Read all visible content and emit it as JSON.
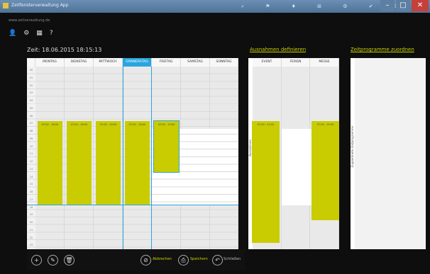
{
  "window": {
    "title": "Zeitfensterverwaltung App",
    "minimize": "–",
    "maximize": "□",
    "close": "✕",
    "toolbar_icons": "⌕ ⚑ ♦ ⊞ ⚙ ✔ ☰"
  },
  "nav": {
    "url": "www.zeitverwaltung.de",
    "user_icon": "👤",
    "settings_icon": "⚙",
    "calendar_icon": "▦",
    "help_icon": "?"
  },
  "header": {
    "zeit": "Zeit: 18.06.2015 18:15:13"
  },
  "links": {
    "ausnahmen": "Ausnahmen definieren",
    "zeitprogramme": "Zeitprogramme zuordnen"
  },
  "week": {
    "days": [
      "MONTAG",
      "DIENSTAG",
      "MITTWOCH",
      "DONNERSTAG",
      "FREITAG",
      "SAMSTAG",
      "SONNTAG"
    ],
    "selected_day": "DONNERSTAG",
    "hours": [
      "00",
      "01",
      "02",
      "03",
      "04",
      "05",
      "06",
      "07",
      "08",
      "09",
      "10",
      "11",
      "12",
      "13",
      "14",
      "15",
      "16",
      "17",
      "18",
      "19",
      "20",
      "21",
      "22",
      "23"
    ],
    "blocks": [
      {
        "day": "MONTAG",
        "label": "07:00 - 16:00"
      },
      {
        "day": "DIENSTAG",
        "label": "07:00 - 16:00"
      },
      {
        "day": "MITTWOCH",
        "label": "07:00 - 16:00"
      },
      {
        "day": "DONNERSTAG",
        "label": "07:00 - 16:00"
      },
      {
        "day": "FREITAG",
        "label": "07:00 - 13:00"
      }
    ]
  },
  "exceptions": {
    "side_label": "Ausnahmen",
    "columns": [
      "EVENT",
      "FERIEN",
      "MESSE"
    ],
    "blocks": [
      {
        "column": "EVENT",
        "label": "07:00 - 22:00"
      },
      {
        "column": "MESSE",
        "label": "07:00 - 19:00"
      }
    ]
  },
  "programs": {
    "side_label": "Zugeordnete Zeitprogramme"
  },
  "bottom": {
    "add_icon": "+",
    "edit_icon": "✎",
    "delete_icon": "🗑",
    "abbrechen_icon": "⊘",
    "abbrechen": "Abbrechen",
    "speichern_icon": "⎙",
    "speichern": "Speichern",
    "schliessen_icon": "↶",
    "schliessen": "Schließen"
  },
  "colors": {
    "accent": "#c8cc00",
    "selected": "#29a6e0"
  }
}
